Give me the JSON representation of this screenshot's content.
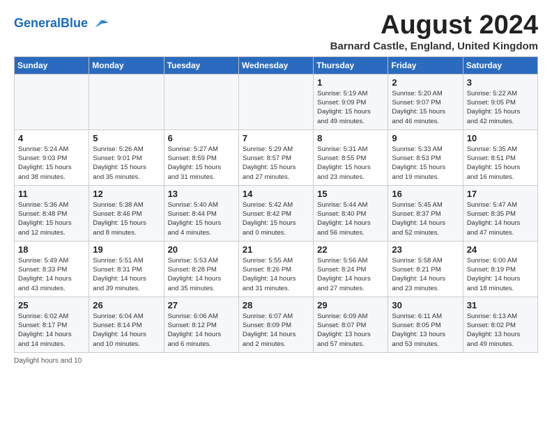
{
  "header": {
    "logo_line1": "General",
    "logo_line2": "Blue",
    "month_title": "August 2024",
    "location": "Barnard Castle, England, United Kingdom"
  },
  "days_of_week": [
    "Sunday",
    "Monday",
    "Tuesday",
    "Wednesday",
    "Thursday",
    "Friday",
    "Saturday"
  ],
  "weeks": [
    [
      {
        "num": "",
        "info": ""
      },
      {
        "num": "",
        "info": ""
      },
      {
        "num": "",
        "info": ""
      },
      {
        "num": "",
        "info": ""
      },
      {
        "num": "1",
        "info": "Sunrise: 5:19 AM\nSunset: 9:09 PM\nDaylight: 15 hours\nand 49 minutes."
      },
      {
        "num": "2",
        "info": "Sunrise: 5:20 AM\nSunset: 9:07 PM\nDaylight: 15 hours\nand 46 minutes."
      },
      {
        "num": "3",
        "info": "Sunrise: 5:22 AM\nSunset: 9:05 PM\nDaylight: 15 hours\nand 42 minutes."
      }
    ],
    [
      {
        "num": "4",
        "info": "Sunrise: 5:24 AM\nSunset: 9:03 PM\nDaylight: 15 hours\nand 38 minutes."
      },
      {
        "num": "5",
        "info": "Sunrise: 5:26 AM\nSunset: 9:01 PM\nDaylight: 15 hours\nand 35 minutes."
      },
      {
        "num": "6",
        "info": "Sunrise: 5:27 AM\nSunset: 8:59 PM\nDaylight: 15 hours\nand 31 minutes."
      },
      {
        "num": "7",
        "info": "Sunrise: 5:29 AM\nSunset: 8:57 PM\nDaylight: 15 hours\nand 27 minutes."
      },
      {
        "num": "8",
        "info": "Sunrise: 5:31 AM\nSunset: 8:55 PM\nDaylight: 15 hours\nand 23 minutes."
      },
      {
        "num": "9",
        "info": "Sunrise: 5:33 AM\nSunset: 8:53 PM\nDaylight: 15 hours\nand 19 minutes."
      },
      {
        "num": "10",
        "info": "Sunrise: 5:35 AM\nSunset: 8:51 PM\nDaylight: 15 hours\nand 16 minutes."
      }
    ],
    [
      {
        "num": "11",
        "info": "Sunrise: 5:36 AM\nSunset: 8:48 PM\nDaylight: 15 hours\nand 12 minutes."
      },
      {
        "num": "12",
        "info": "Sunrise: 5:38 AM\nSunset: 8:46 PM\nDaylight: 15 hours\nand 8 minutes."
      },
      {
        "num": "13",
        "info": "Sunrise: 5:40 AM\nSunset: 8:44 PM\nDaylight: 15 hours\nand 4 minutes."
      },
      {
        "num": "14",
        "info": "Sunrise: 5:42 AM\nSunset: 8:42 PM\nDaylight: 15 hours\nand 0 minutes."
      },
      {
        "num": "15",
        "info": "Sunrise: 5:44 AM\nSunset: 8:40 PM\nDaylight: 14 hours\nand 56 minutes."
      },
      {
        "num": "16",
        "info": "Sunrise: 5:45 AM\nSunset: 8:37 PM\nDaylight: 14 hours\nand 52 minutes."
      },
      {
        "num": "17",
        "info": "Sunrise: 5:47 AM\nSunset: 8:35 PM\nDaylight: 14 hours\nand 47 minutes."
      }
    ],
    [
      {
        "num": "18",
        "info": "Sunrise: 5:49 AM\nSunset: 8:33 PM\nDaylight: 14 hours\nand 43 minutes."
      },
      {
        "num": "19",
        "info": "Sunrise: 5:51 AM\nSunset: 8:31 PM\nDaylight: 14 hours\nand 39 minutes."
      },
      {
        "num": "20",
        "info": "Sunrise: 5:53 AM\nSunset: 8:28 PM\nDaylight: 14 hours\nand 35 minutes."
      },
      {
        "num": "21",
        "info": "Sunrise: 5:55 AM\nSunset: 8:26 PM\nDaylight: 14 hours\nand 31 minutes."
      },
      {
        "num": "22",
        "info": "Sunrise: 5:56 AM\nSunset: 8:24 PM\nDaylight: 14 hours\nand 27 minutes."
      },
      {
        "num": "23",
        "info": "Sunrise: 5:58 AM\nSunset: 8:21 PM\nDaylight: 14 hours\nand 23 minutes."
      },
      {
        "num": "24",
        "info": "Sunrise: 6:00 AM\nSunset: 8:19 PM\nDaylight: 14 hours\nand 18 minutes."
      }
    ],
    [
      {
        "num": "25",
        "info": "Sunrise: 6:02 AM\nSunset: 8:17 PM\nDaylight: 14 hours\nand 14 minutes."
      },
      {
        "num": "26",
        "info": "Sunrise: 6:04 AM\nSunset: 8:14 PM\nDaylight: 14 hours\nand 10 minutes."
      },
      {
        "num": "27",
        "info": "Sunrise: 6:06 AM\nSunset: 8:12 PM\nDaylight: 14 hours\nand 6 minutes."
      },
      {
        "num": "28",
        "info": "Sunrise: 6:07 AM\nSunset: 8:09 PM\nDaylight: 14 hours\nand 2 minutes."
      },
      {
        "num": "29",
        "info": "Sunrise: 6:09 AM\nSunset: 8:07 PM\nDaylight: 13 hours\nand 57 minutes."
      },
      {
        "num": "30",
        "info": "Sunrise: 6:11 AM\nSunset: 8:05 PM\nDaylight: 13 hours\nand 53 minutes."
      },
      {
        "num": "31",
        "info": "Sunrise: 6:13 AM\nSunset: 8:02 PM\nDaylight: 13 hours\nand 49 minutes."
      }
    ]
  ],
  "footer": "Daylight hours and 10"
}
